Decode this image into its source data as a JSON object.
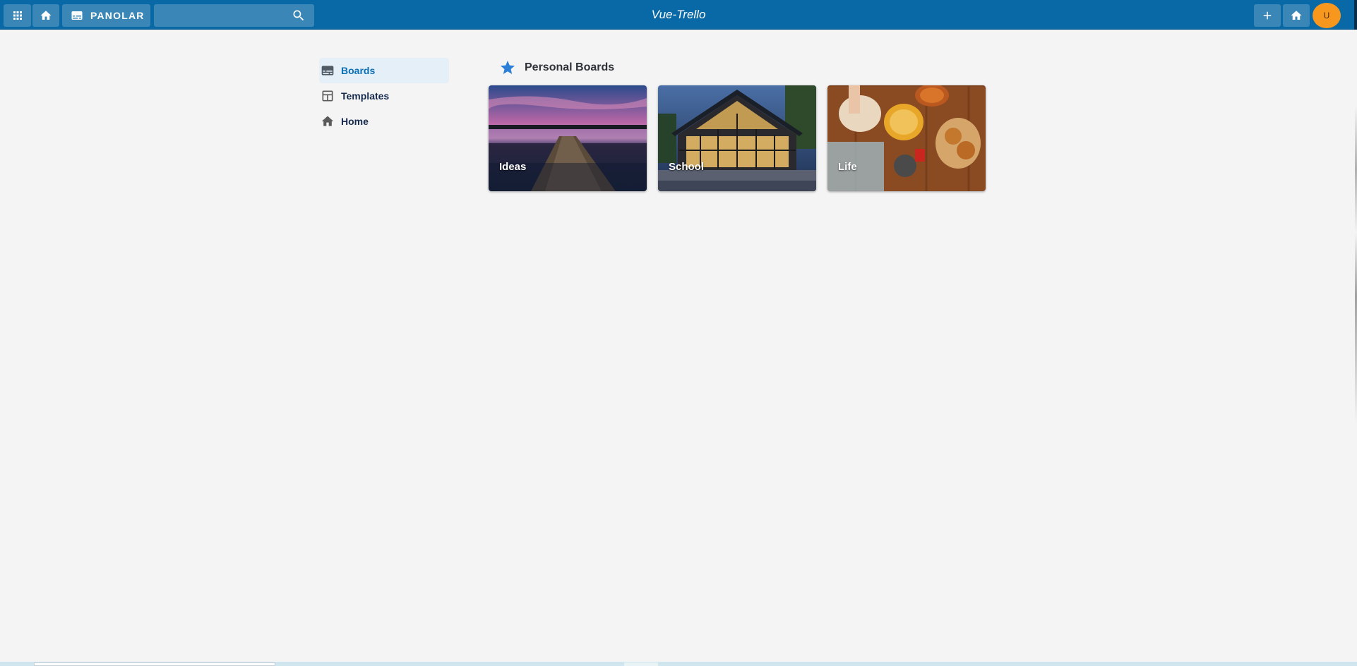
{
  "topbar": {
    "boards_label": "PANOLAR",
    "search_placeholder": "",
    "app_title": "Vue-Trello",
    "avatar_initial": "U",
    "bg_color": "#0969a6",
    "avatar_color": "#f7971e"
  },
  "sidebar": {
    "items": [
      {
        "label": "Boards",
        "icon": "board-icon",
        "active": true
      },
      {
        "label": "Templates",
        "icon": "template-icon",
        "active": false
      },
      {
        "label": "Home",
        "icon": "home-icon",
        "active": false
      }
    ]
  },
  "main": {
    "section_title": "Personal Boards",
    "section_icon": "star-icon",
    "boards": [
      {
        "name": "Ideas",
        "image": "lake pier at sunset"
      },
      {
        "name": "School",
        "image": "modern glass house at dusk"
      },
      {
        "name": "Life",
        "image": "baking on wooden table"
      }
    ]
  }
}
